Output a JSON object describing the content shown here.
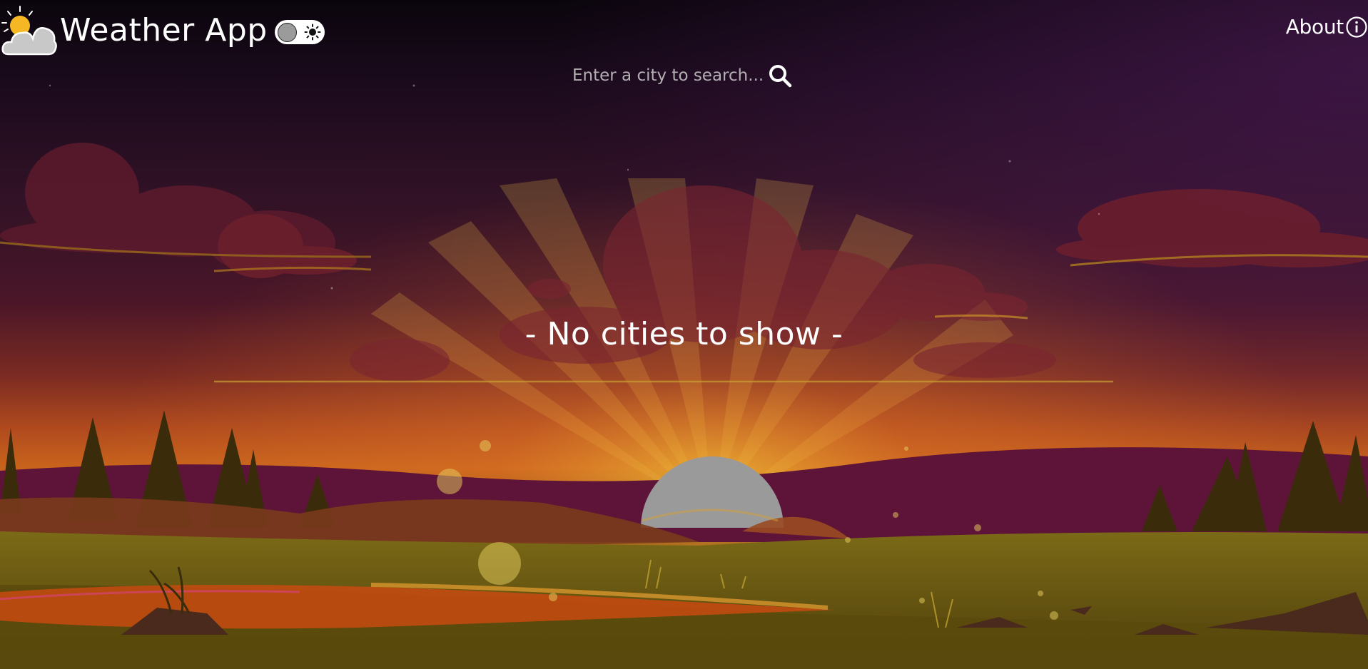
{
  "header": {
    "title": "Weather App",
    "about_label": "About"
  },
  "theme_toggle": {
    "state": "light"
  },
  "search": {
    "placeholder": "Enter a city to search...",
    "value": ""
  },
  "main": {
    "empty_message": "- No cities to show -"
  },
  "icons": {
    "logo": "sun-behind-cloud-icon",
    "toggle": "sun-icon",
    "about": "info-icon",
    "search": "magnifier-icon"
  },
  "colors": {
    "text": "#ffffff",
    "sky_top": "#0d0610",
    "sky_mid": "#5a1628",
    "horizon": "#e0641e",
    "sun": "#9a9a9a",
    "grass": "#6b5a10",
    "placeholder": "#b3aeb2"
  }
}
